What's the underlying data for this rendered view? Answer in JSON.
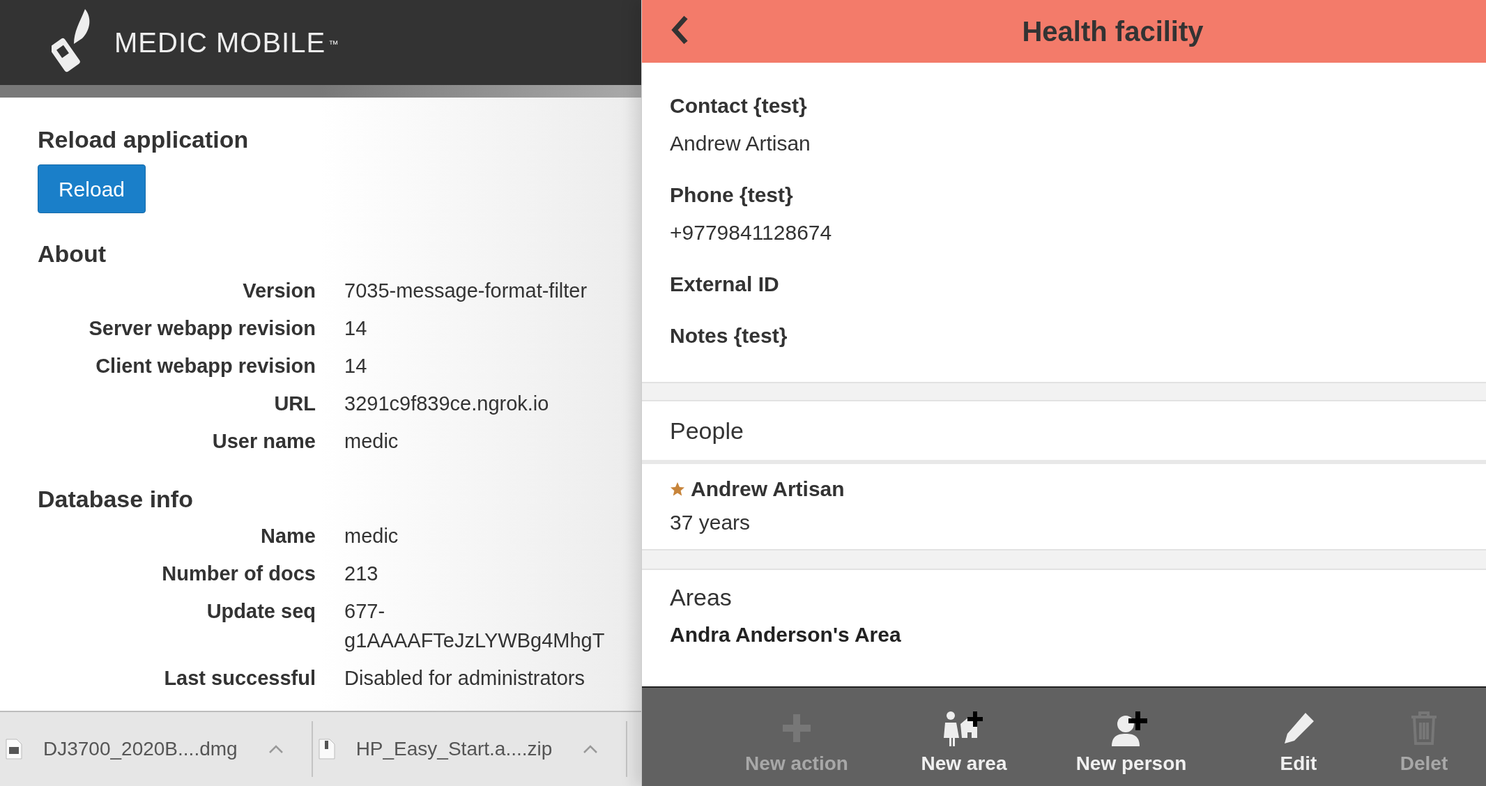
{
  "left_header": {
    "logo_text": "MEDIC MOBILE",
    "trademark": "™"
  },
  "reload": {
    "heading": "Reload application",
    "button": "Reload"
  },
  "about": {
    "heading": "About",
    "rows": [
      {
        "label": "Version",
        "value": "7035-message-format-filter"
      },
      {
        "label": "Server webapp revision",
        "value": "14"
      },
      {
        "label": "Client webapp revision",
        "value": "14"
      },
      {
        "label": "URL",
        "value": "3291c9f839ce.ngrok.io"
      },
      {
        "label": "User name",
        "value": "medic"
      }
    ]
  },
  "database": {
    "heading": "Database info",
    "rows": [
      {
        "label": "Name",
        "value": "medic"
      },
      {
        "label": "Number of docs",
        "value": "213"
      },
      {
        "label": "Update seq",
        "value": "677-\ng1AAAAFTeJzLYWBg4MhgT"
      },
      {
        "label": "Last successful",
        "value": "Disabled for administrators"
      }
    ]
  },
  "downloads": [
    {
      "name": "DJ3700_2020B....dmg",
      "kind": "dmg"
    },
    {
      "name": "HP_Easy_Start.a....zip",
      "kind": "zip"
    }
  ],
  "right_header": {
    "title": "Health facility"
  },
  "fields": [
    {
      "label": "Contact {test}",
      "value": "Andrew Artisan"
    },
    {
      "label": "Phone {test}",
      "value": "+9779841128674"
    },
    {
      "label": "External ID"
    },
    {
      "label": "Notes {test}"
    }
  ],
  "people": {
    "heading": "People",
    "items": [
      {
        "name": "Andrew Artisan",
        "primary": true,
        "age": "37 years"
      }
    ]
  },
  "areas": {
    "heading": "Areas",
    "items": [
      {
        "name": "Andra Anderson's Area"
      }
    ]
  },
  "actions": [
    {
      "label": "New action",
      "kind": "plus",
      "disabled": true
    },
    {
      "label": "New area",
      "kind": "area",
      "disabled": false
    },
    {
      "label": "New person",
      "kind": "person",
      "disabled": false
    },
    {
      "label": "Edit",
      "kind": "edit",
      "disabled": false
    },
    {
      "label": "Delet",
      "kind": "delete",
      "disabled": true
    }
  ]
}
